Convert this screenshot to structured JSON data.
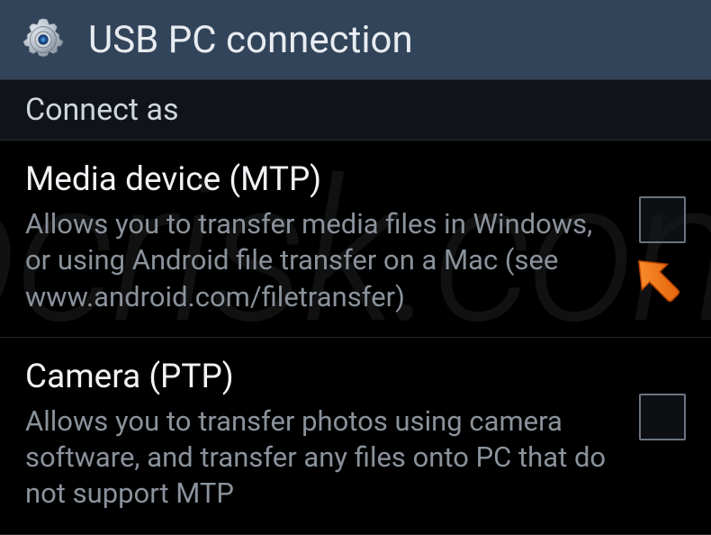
{
  "header": {
    "title": "USB PC connection"
  },
  "section": {
    "title": "Connect as"
  },
  "options": [
    {
      "title": "Media device (MTP)",
      "description": "Allows you to transfer media files in Windows, or using Android file transfer on a Mac (see www.android.com/filetransfer)",
      "checked": false
    },
    {
      "title": "Camera (PTP)",
      "description": "Allows you to transfer photos using camera software, and transfer any files onto PC that do not support MTP",
      "checked": false
    }
  ],
  "watermark": "pcrisk.com"
}
